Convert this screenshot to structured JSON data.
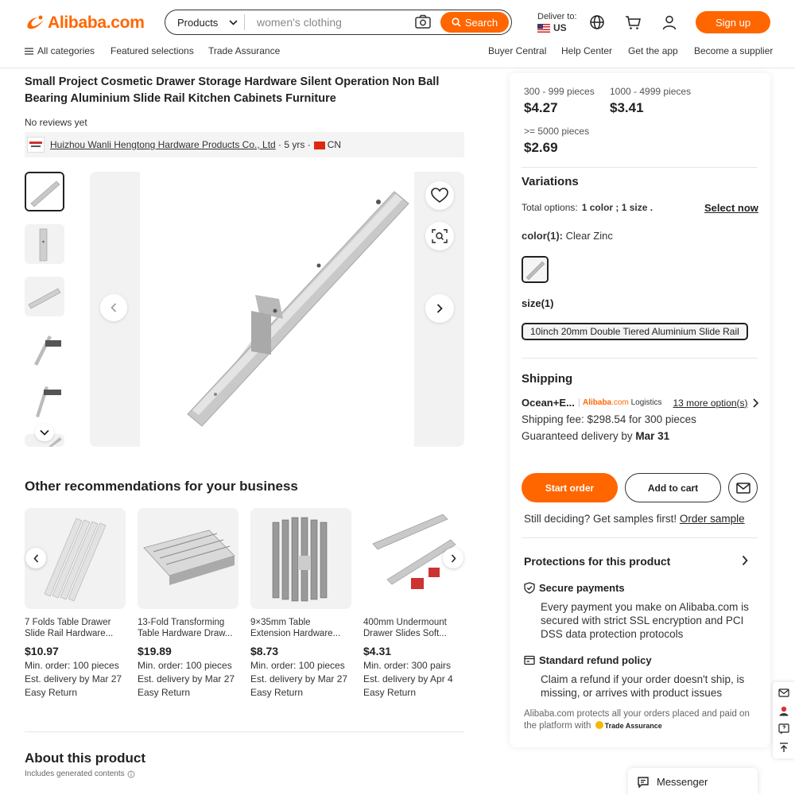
{
  "header": {
    "logo_text": "Alibaba.com",
    "search_category": "Products",
    "search_placeholder": "women's clothing",
    "search_button": "Search",
    "deliver_label": "Deliver to:",
    "deliver_country": "US",
    "signup_label": "Sign up",
    "accent": "#ff6600"
  },
  "nav": {
    "all_categories": "All categories",
    "featured": "Featured selections",
    "trade_assurance": "Trade Assurance",
    "buyer_central": "Buyer Central",
    "help_center": "Help Center",
    "get_app": "Get the app",
    "become_supplier": "Become a supplier"
  },
  "product": {
    "title": "Small Project Cosmetic Drawer Storage Hardware Silent Operation Non Ball Bearing Aluminium Slide Rail Kitchen Cabinets Furniture",
    "reviews": "No reviews yet",
    "supplier_name": "Huizhou Wanli Hengtong Hardware Products Co., Ltd",
    "supplier_years": "5 yrs",
    "supplier_country": "CN"
  },
  "recommendations": {
    "title": "Other recommendations for your business",
    "items": [
      {
        "name": "7 Folds Table Drawer Slide Rail Hardware...",
        "price": "$10.97",
        "min_order": "Min. order: 100 pieces",
        "delivery": "Est. delivery by Mar 27",
        "returns": "Easy Return"
      },
      {
        "name": "13-Fold Transforming Table Hardware Draw...",
        "price": "$19.89",
        "min_order": "Min. order: 100 pieces",
        "delivery": "Est. delivery by Mar 27",
        "returns": "Easy Return"
      },
      {
        "name": "9×35mm Table Extension Hardware...",
        "price": "$8.73",
        "min_order": "Min. order: 100 pieces",
        "delivery": "Est. delivery by Mar 27",
        "returns": "Easy Return"
      },
      {
        "name": "400mm Undermount Drawer Slides Soft...",
        "price": "$4.31",
        "min_order": "Min. order: 300 pairs",
        "delivery": "Est. delivery by Apr 4",
        "returns": "Easy Return"
      }
    ]
  },
  "about": {
    "title": "About this product",
    "generated": "Includes generated contents"
  },
  "pricing": {
    "tiers": [
      {
        "qty": "300 - 999 pieces",
        "price": "$4.27"
      },
      {
        "qty": "1000 - 4999 pieces",
        "price": "$3.41"
      },
      {
        "qty": ">= 5000 pieces",
        "price": "$2.69"
      }
    ]
  },
  "variations": {
    "title": "Variations",
    "total_label": "Total options:",
    "total_value": "1 color ; 1 size .",
    "select_now": "Select now",
    "color_label": "color(1):",
    "color_value": "Clear Zinc",
    "size_label": "size(1)",
    "size_value": "10inch 20mm Double Tiered Aluminium Slide Rail"
  },
  "shipping": {
    "title": "Shipping",
    "method": "Ocean+E...",
    "logistics_brand": "Alibaba",
    "logistics_suffix": ".com",
    "logistics_word": "Logistics",
    "more_options": "13 more option(s)",
    "fee": "Shipping fee: $298.54 for 300 pieces",
    "guaranteed_prefix": "Guaranteed delivery by",
    "guaranteed_date": "Mar 31"
  },
  "actions": {
    "start_order": "Start order",
    "add_to_cart": "Add to cart",
    "samples_text": "Still deciding? Get samples first!",
    "order_sample": "Order sample"
  },
  "protections": {
    "title": "Protections for this product",
    "secure_title": "Secure payments",
    "secure_body": "Every payment you make on Alibaba.com is secured with strict SSL encryption and PCI DSS data protection protocols",
    "refund_title": "Standard refund policy",
    "refund_body": "Claim a refund if your order doesn't ship, is missing, or arrives with product issues",
    "footnote": "Alibaba.com protects all your orders placed and paid on the platform with",
    "trade_assurance": "Trade Assurance"
  },
  "messenger": {
    "label": "Messenger"
  }
}
